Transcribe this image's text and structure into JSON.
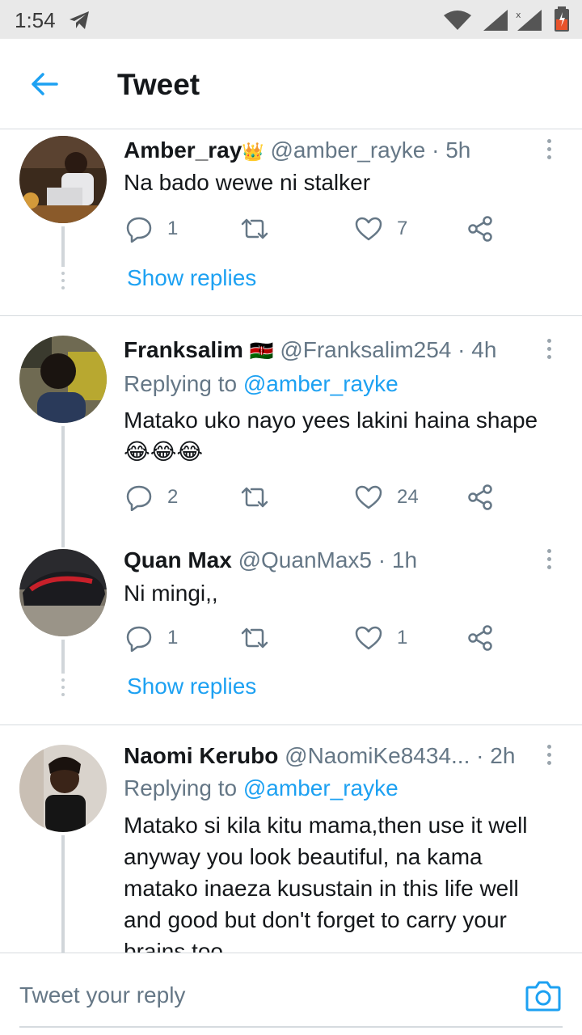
{
  "status_bar": {
    "time": "1:54"
  },
  "header": {
    "title": "Tweet"
  },
  "tweets": [
    {
      "name": "Amber_ray",
      "name_suffix": "👑",
      "handle": "@amber_rayke",
      "time": "· 5h",
      "replying_to": "",
      "text": "Na bado wewe ni stalker",
      "replies": "1",
      "retweets": "",
      "likes": "7",
      "show_replies": "Show replies"
    },
    {
      "name": "Franksalim",
      "name_suffix": "🇰🇪",
      "handle": "@Franksalim254",
      "time": "· 4h",
      "replying_label": "Replying to",
      "replying_to": "@amber_rayke",
      "text": "Matako uko nayo yees lakini haina shape",
      "text_line2": "😂😂😂",
      "replies": "2",
      "retweets": "",
      "likes": "24"
    },
    {
      "name": "Quan Max",
      "handle": "@QuanMax5",
      "time": "· 1h",
      "text": "Ni mingi,,",
      "replies": "1",
      "retweets": "",
      "likes": "1",
      "show_replies": "Show replies"
    },
    {
      "name": "Naomi Kerubo",
      "handle": "@NaomiKe8434...",
      "time": "· 2h",
      "replying_label": "Replying to",
      "replying_to": "@amber_rayke",
      "text_lines": [
        "Matako si kila kitu mama,then use it well",
        "anyway you look beautiful, na kama",
        "matako inaeza kusustain in this life well",
        "and good but don't forget to carry your",
        "brains too"
      ]
    }
  ],
  "reply_bar": {
    "placeholder": "Tweet your reply"
  },
  "colors": {
    "accent": "#1da1f2",
    "secondary_text": "#657786",
    "divider": "#d6dbdf"
  },
  "icons": [
    "back-arrow-icon",
    "reply-icon",
    "retweet-icon",
    "like-icon",
    "share-icon",
    "more-icon",
    "camera-icon"
  ]
}
